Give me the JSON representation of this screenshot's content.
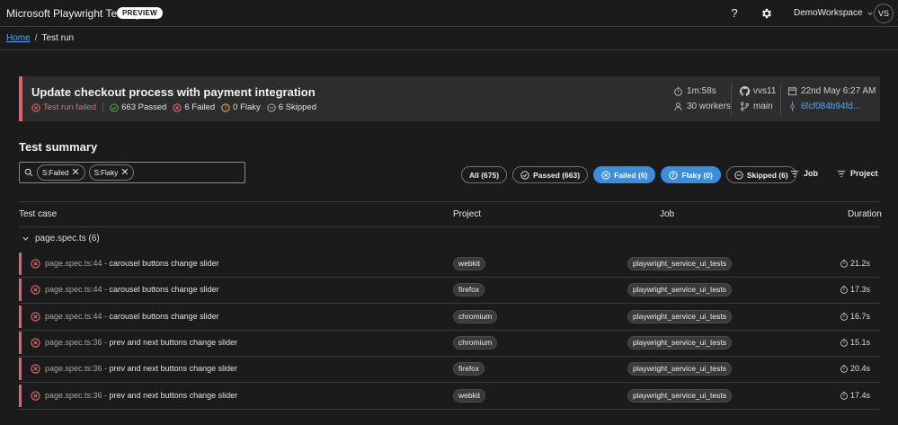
{
  "app": {
    "title": "Microsoft Playwright Testing",
    "badge": "PREVIEW"
  },
  "header": {
    "help_glyph": "?",
    "workspace": "DemoWorkspace",
    "avatar_initials": "VS"
  },
  "breadcrumb": {
    "home": "Home",
    "separator": "/",
    "current": "Test run"
  },
  "run": {
    "title": "Update checkout process with payment integration",
    "status": "Test run failed",
    "passed": "663 Passed",
    "failed": "6 Failed",
    "flaky": "0 Flaky",
    "skipped": "6 Skipped",
    "duration": "1m:58s",
    "workers": "30 workers",
    "user": "vvs11",
    "branch": "main",
    "date": "22nd May 6:27 AM",
    "commit": "6fcf084b94fd..."
  },
  "summary": {
    "title": "Test summary",
    "chips": [
      "S:Failed",
      "S:Flaky"
    ],
    "pills": {
      "all": "All (675)",
      "passed": "Passed (663)",
      "failed": "Failed (6)",
      "flaky": "Flaky (0)",
      "skipped": "Skipped (6)"
    },
    "group_job": "Job",
    "group_project": "Project"
  },
  "table": {
    "columns": {
      "case": "Test case",
      "project": "Project",
      "job": "Job",
      "duration": "Duration"
    },
    "group_label": "page.spec.ts (6)",
    "rows": [
      {
        "file": "page.spec.ts:44",
        "sep": " - ",
        "name": "carousel buttons change slider",
        "project": "webkit",
        "job": "playwright_service_ui_tests",
        "duration": "21.2s"
      },
      {
        "file": "page.spec.ts:44",
        "sep": " - ",
        "name": "carousel buttons change slider",
        "project": "firefox",
        "job": "playwright_service_ui_tests",
        "duration": "17.3s"
      },
      {
        "file": "page.spec.ts:44",
        "sep": " - ",
        "name": "carousel buttons change slider",
        "project": "chromium",
        "job": "playwright_service_ui_tests",
        "duration": "16.7s"
      },
      {
        "file": "page.spec.ts:36",
        "sep": " - ",
        "name": "prev and next buttons change slider",
        "project": "chromium",
        "job": "playwright_service_ui_tests",
        "duration": "15.1s"
      },
      {
        "file": "page.spec.ts:36",
        "sep": " - ",
        "name": "prev and next buttons change slider",
        "project": "firefox",
        "job": "playwright_service_ui_tests",
        "duration": "20.4s"
      },
      {
        "file": "page.spec.ts:36",
        "sep": " - ",
        "name": "prev and next buttons change slider",
        "project": "webkit",
        "job": "playwright_service_ui_tests",
        "duration": "17.4s"
      }
    ]
  },
  "colors": {
    "failed": "#e0646e",
    "passed": "#4caf50",
    "flaky": "#e3b341",
    "accent": "#3b8edb",
    "link": "#5ba3f0"
  }
}
